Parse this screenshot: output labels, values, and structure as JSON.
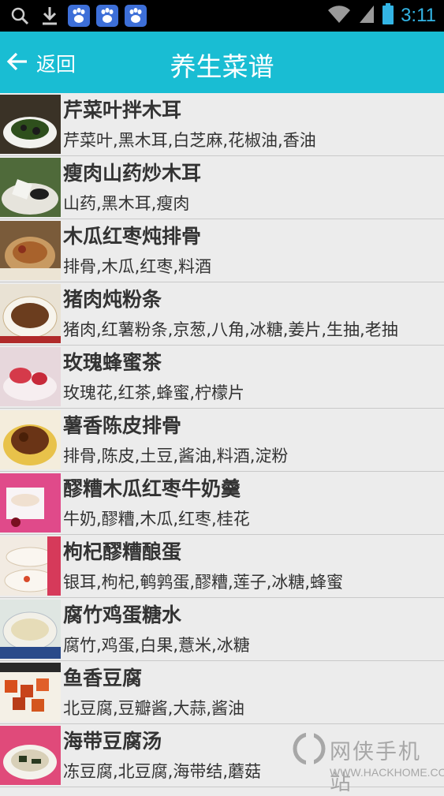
{
  "status_bar": {
    "time": "3:11",
    "icons": [
      "search-icon",
      "download-icon",
      "baidu-paw-icon",
      "baidu-paw-icon",
      "baidu-paw-icon",
      "wifi-icon",
      "signal-icon",
      "battery-icon"
    ]
  },
  "header": {
    "back_label": "返回",
    "title": "养生菜谱",
    "color": "#19bdd3"
  },
  "recipes": [
    {
      "name": "芹菜叶拌木耳",
      "ingredients": "芹菜叶,黑木耳,白芝麻,花椒油,香油"
    },
    {
      "name": "瘦肉山药炒木耳",
      "ingredients": "山药,黑木耳,瘦肉"
    },
    {
      "name": "木瓜红枣炖排骨",
      "ingredients": "排骨,木瓜,红枣,料酒"
    },
    {
      "name": "猪肉炖粉条",
      "ingredients": "猪肉,红薯粉条,京葱,八角,冰糖,姜片,生抽,老抽"
    },
    {
      "name": "玫瑰蜂蜜茶",
      "ingredients": "玫瑰花,红茶,蜂蜜,柠檬片"
    },
    {
      "name": "薯香陈皮排骨",
      "ingredients": "排骨,陈皮,土豆,酱油,料酒,淀粉"
    },
    {
      "name": "醪糟木瓜红枣牛奶羹",
      "ingredients": "牛奶,醪糟,木瓜,红枣,桂花"
    },
    {
      "name": "枸杞醪糟酿蛋",
      "ingredients": "银耳,枸杞,鹌鹑蛋,醪糟,莲子,冰糖,蜂蜜"
    },
    {
      "name": "腐竹鸡蛋糖水",
      "ingredients": "腐竹,鸡蛋,白果,薏米,冰糖"
    },
    {
      "name": "鱼香豆腐",
      "ingredients": "北豆腐,豆瓣酱,大蒜,酱油"
    },
    {
      "name": "海带豆腐汤",
      "ingredients": "冻豆腐,北豆腐,海带结,蘑菇"
    }
  ],
  "watermark": {
    "brand": "网侠手机站",
    "url": "WWW.HACKHOME.COM"
  }
}
